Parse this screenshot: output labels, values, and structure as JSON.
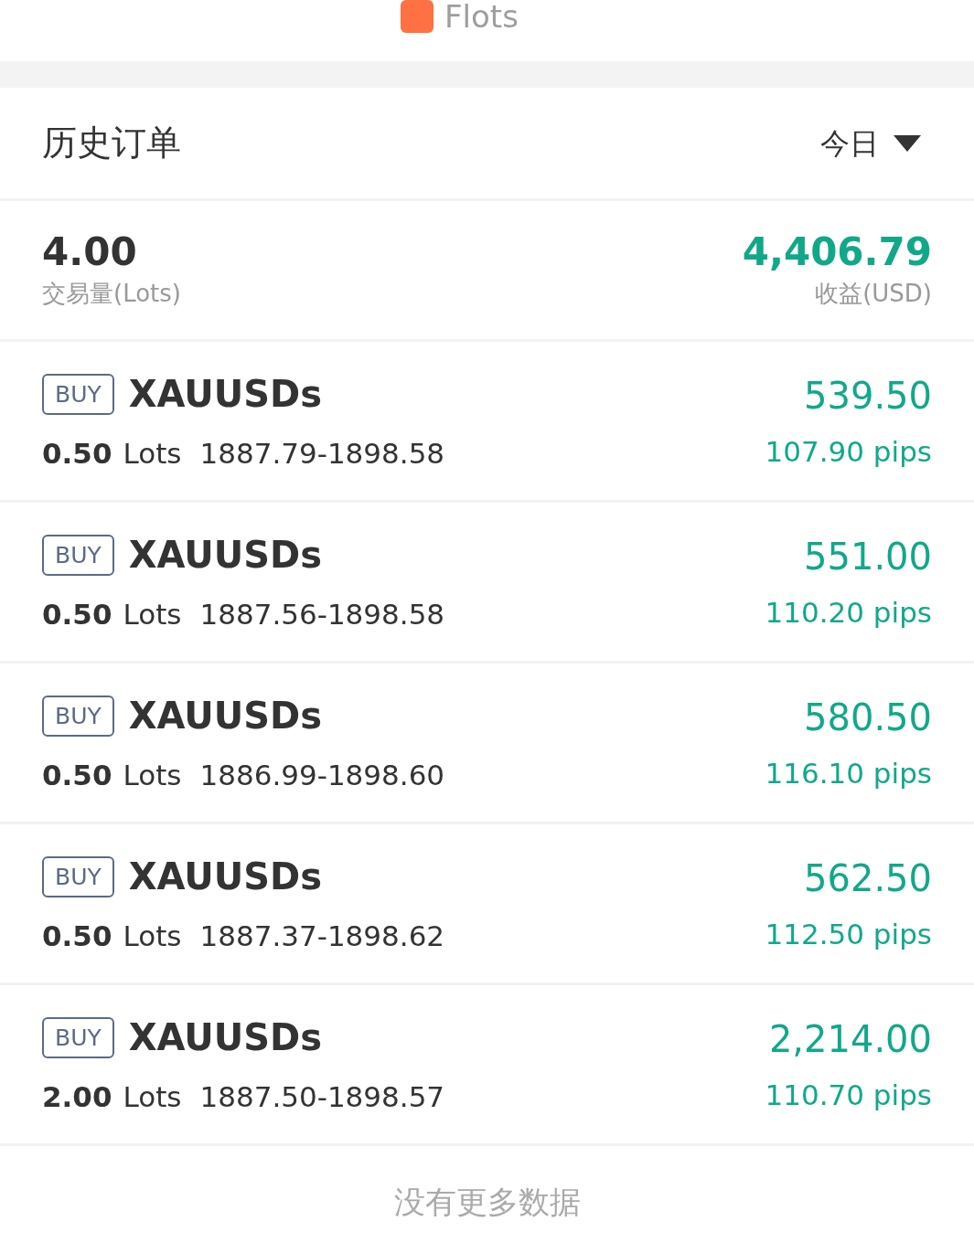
{
  "legend": {
    "label": "Flots",
    "color": "#ff7043"
  },
  "header": {
    "title": "历史订单",
    "period": "今日"
  },
  "summary": {
    "volume": "4.00",
    "volume_label": "交易量(Lots)",
    "profit": "4,406.79",
    "profit_label": "收益(USD)"
  },
  "orders": [
    {
      "side": "BUY",
      "symbol": "XAUUSDs",
      "lots": "0.50",
      "unit": "Lots",
      "range": "1887.79-1898.58",
      "profit": "539.50",
      "pips": "107.90 pips"
    },
    {
      "side": "BUY",
      "symbol": "XAUUSDs",
      "lots": "0.50",
      "unit": "Lots",
      "range": "1887.56-1898.58",
      "profit": "551.00",
      "pips": "110.20 pips"
    },
    {
      "side": "BUY",
      "symbol": "XAUUSDs",
      "lots": "0.50",
      "unit": "Lots",
      "range": "1886.99-1898.60",
      "profit": "580.50",
      "pips": "116.10 pips"
    },
    {
      "side": "BUY",
      "symbol": "XAUUSDs",
      "lots": "0.50",
      "unit": "Lots",
      "range": "1887.37-1898.62",
      "profit": "562.50",
      "pips": "112.50 pips"
    },
    {
      "side": "BUY",
      "symbol": "XAUUSDs",
      "lots": "2.00",
      "unit": "Lots",
      "range": "1887.50-1898.57",
      "profit": "2,214.00",
      "pips": "110.70 pips"
    }
  ],
  "footer": "没有更多数据"
}
